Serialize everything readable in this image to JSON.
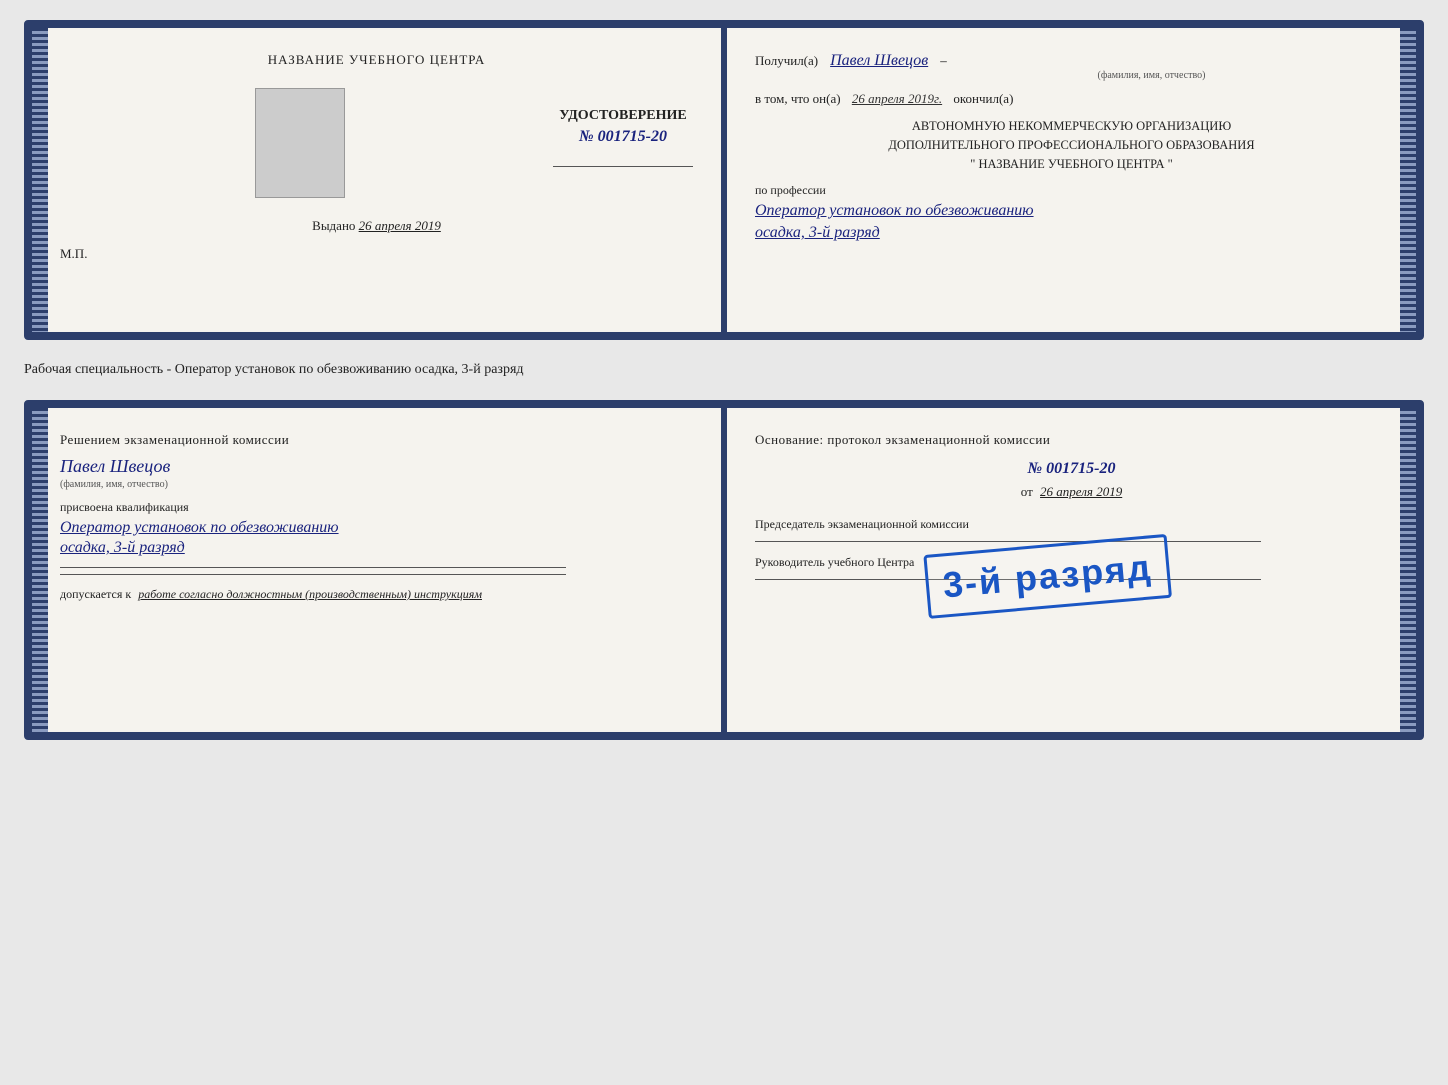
{
  "doc1": {
    "left": {
      "center_title": "НАЗВАНИЕ УЧЕБНОГО ЦЕНТРА",
      "cert_label": "УДОСТОВЕРЕНИЕ",
      "cert_number": "№ 001715-20",
      "issued_label": "Выдано",
      "issued_date": "26 апреля 2019",
      "mp_label": "М.П."
    },
    "right": {
      "received_prefix": "Получил(а)",
      "recipient_name": "Павел Швецов",
      "fio_label": "(фамилия, имя, отчество)",
      "dash": "–",
      "date_prefix": "в том, что он(а)",
      "date_value": "26 апреля 2019г.",
      "date_suffix": "окончил(а)",
      "org_line1": "АВТОНОМНУЮ НЕКОММЕРЧЕСКУЮ ОРГАНИЗАЦИЮ",
      "org_line2": "ДОПОЛНИТЕЛЬНОГО ПРОФЕССИОНАЛЬНОГО ОБРАЗОВАНИЯ",
      "org_line3": "\" НАЗВАНИЕ УЧЕБНОГО ЦЕНТРА \"",
      "profession_label": "по профессии",
      "profession_value": "Оператор установок по обезвоживанию",
      "specialization": "осадка, 3-й разряд"
    }
  },
  "between_label": "Рабочая специальность - Оператор установок по обезвоживанию осадка, 3-й разряд",
  "doc2": {
    "left": {
      "decision_text": "Решением экзаменационной комиссии",
      "person_name": "Павел Швецов",
      "fio_label": "(фамилия, имя, отчество)",
      "qualification_prefix": "присвоена квалификация",
      "qualification_line1": "Оператор установок по обезвоживанию",
      "qualification_line2": "осадка, 3-й разряд",
      "allowed_prefix": "допускается к",
      "allowed_value": "работе согласно должностным (производственным) инструкциям"
    },
    "right": {
      "basis_text": "Основание: протокол экзаменационной комиссии",
      "protocol_number": "№ 001715-20",
      "from_prefix": "от",
      "from_date": "26 апреля 2019",
      "chairman_label": "Председатель экзаменационной комиссии",
      "director_label": "Руководитель учебного Центра"
    },
    "stamp": {
      "text": "3-й разряд"
    }
  }
}
